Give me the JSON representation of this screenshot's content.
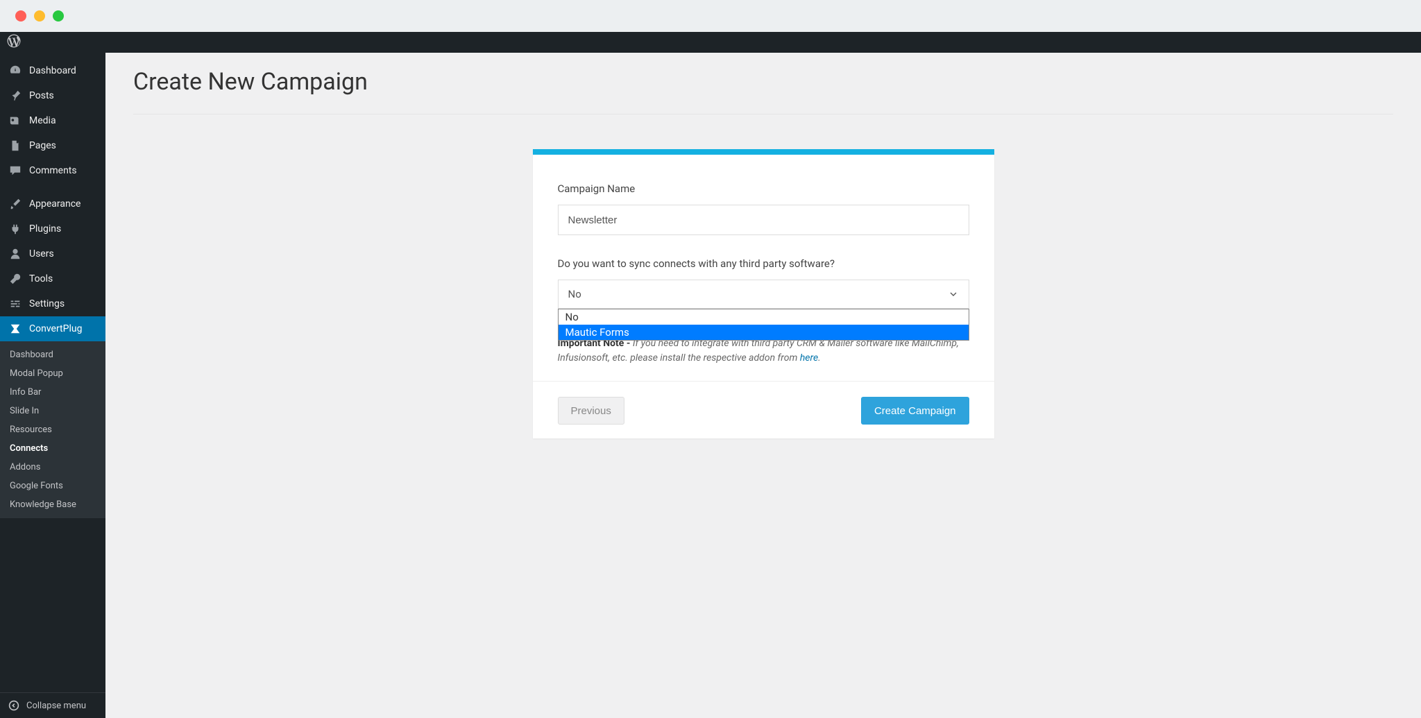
{
  "sidebar": {
    "items": [
      {
        "label": "Dashboard",
        "icon": "dashboard"
      },
      {
        "label": "Posts",
        "icon": "pin"
      },
      {
        "label": "Media",
        "icon": "media"
      },
      {
        "label": "Pages",
        "icon": "pages"
      },
      {
        "label": "Comments",
        "icon": "comment"
      },
      {
        "label": "Appearance",
        "icon": "brush"
      },
      {
        "label": "Plugins",
        "icon": "plug"
      },
      {
        "label": "Users",
        "icon": "user"
      },
      {
        "label": "Tools",
        "icon": "wrench"
      },
      {
        "label": "Settings",
        "icon": "sliders"
      },
      {
        "label": "ConvertPlug",
        "icon": "convertplug",
        "active": true
      }
    ],
    "submenu": [
      {
        "label": "Dashboard"
      },
      {
        "label": "Modal Popup"
      },
      {
        "label": "Info Bar"
      },
      {
        "label": "Slide In"
      },
      {
        "label": "Resources"
      },
      {
        "label": "Connects",
        "active": true
      },
      {
        "label": "Addons"
      },
      {
        "label": "Google Fonts"
      },
      {
        "label": "Knowledge Base"
      }
    ],
    "collapse": "Collapse menu"
  },
  "page": {
    "title": "Create New Campaign"
  },
  "form": {
    "campaign_label": "Campaign Name",
    "campaign_value": "Newsletter",
    "sync_label": "Do you want to sync connects with any third party software?",
    "sync_selected": "No",
    "sync_options": [
      "No",
      "Mautic Forms"
    ],
    "note_prefix": "Important Note",
    "note_body": "If you need to integrate with third party CRM & Mailer software like MailChimp, Infusionsoft, etc. please install the respective addon from ",
    "note_link": "here",
    "prev": "Previous",
    "create": "Create Campaign"
  }
}
